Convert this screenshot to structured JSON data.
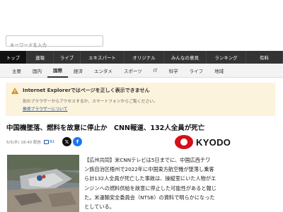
{
  "search": {
    "placeholder": "キーワードを入力"
  },
  "global_nav": [
    {
      "label": "トップ",
      "active": true
    },
    {
      "label": "速報"
    },
    {
      "label": "ライブ"
    },
    {
      "label": "エキスパート"
    },
    {
      "label": "オリジナル"
    },
    {
      "label": "みんなの意見"
    },
    {
      "label": "ランキング"
    },
    {
      "label": "有料"
    }
  ],
  "sub_nav": [
    {
      "label": "主要"
    },
    {
      "label": "国内"
    },
    {
      "label": "国際",
      "active": true
    },
    {
      "label": "経済"
    },
    {
      "label": "エンタメ"
    },
    {
      "label": "スポーツ"
    },
    {
      "label": "IT"
    },
    {
      "label": "科学"
    },
    {
      "label": "ライフ"
    },
    {
      "label": "地域"
    }
  ],
  "notice": {
    "title": "Internet Explorerではページを正しく表示できません",
    "message": "別のブラウザーからアクセスするか、スマートフォンからご覧ください。",
    "link": "推奨ブラウザーについて"
  },
  "article": {
    "headline": "中国機墜落、燃料を故意に停止か　CNN報道、132人全員が死亡",
    "date": "5/5(木) 18:40 配信",
    "comment_count": "91",
    "publisher": "KYODO",
    "body_lines": [
      "【広州共同】米CNNテレビは5日までに、中国広西チワ",
      "ン族自治区梧州で2022年に中国東方航空機が墜落し乗客",
      "ら計132人全員が死亡した事故は、操縦室にいた人物がエ",
      "ンジンへの燃料供給を故意に停止した可能性があると報じ",
      "た。米運輸安全委員会（NTSB）の資料で明らかになった",
      "としている。"
    ]
  },
  "colors": {
    "nav_bg": "#333333",
    "notice_bg": "#fbf3dc",
    "kyodo_red": "#d4101a",
    "link": "#1a55a8"
  }
}
